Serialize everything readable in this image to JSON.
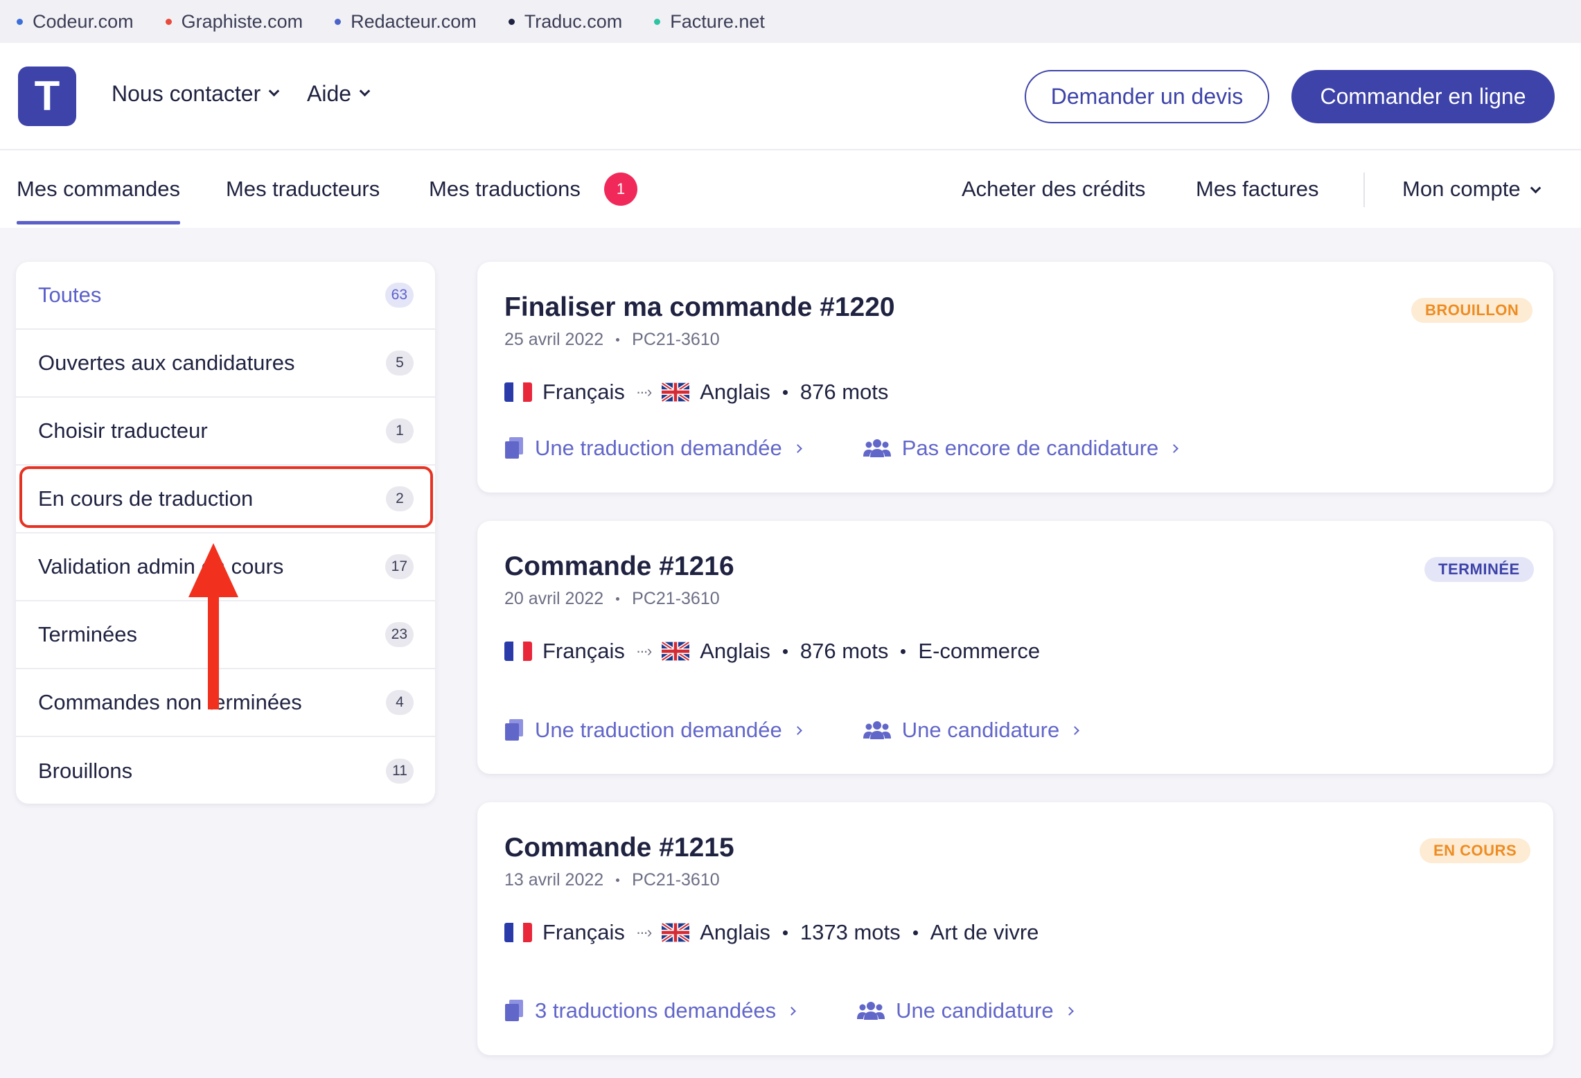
{
  "network": [
    {
      "label": "Codeur.com",
      "color": "#3d6fd8"
    },
    {
      "label": "Graphiste.com",
      "color": "#e84b3c"
    },
    {
      "label": "Redacteur.com",
      "color": "#4b63c9"
    },
    {
      "label": "Traduc.com",
      "color": "#1f2240"
    },
    {
      "label": "Facture.net",
      "color": "#2ec4a3"
    }
  ],
  "header": {
    "logo_letter": "T",
    "contact_label": "Nous contacter",
    "help_label": "Aide",
    "quote_button": "Demander un devis",
    "order_button": "Commander en ligne"
  },
  "nav": {
    "orders": "Mes commandes",
    "translators": "Mes traducteurs",
    "translations": "Mes traductions",
    "translations_badge": "1",
    "credits": "Acheter des crédits",
    "invoices": "Mes factures",
    "account": "Mon compte"
  },
  "sidebar": {
    "items": [
      {
        "label": "Toutes",
        "count": "63"
      },
      {
        "label": "Ouvertes aux candidatures",
        "count": "5"
      },
      {
        "label": "Choisir traducteur",
        "count": "1"
      },
      {
        "label": "En cours de traduction",
        "count": "2"
      },
      {
        "label": "Validation admin en cours",
        "count": "17"
      },
      {
        "label": "Terminées",
        "count": "23"
      },
      {
        "label": "Commandes non terminées",
        "count": "4"
      },
      {
        "label": "Brouillons",
        "count": "11"
      }
    ]
  },
  "orders": [
    {
      "title": "Finaliser ma commande #1220",
      "date": "25 avril 2022",
      "ref": "PC21-3610",
      "status": "BROUILLON",
      "source_lang": "Français",
      "target_lang": "Anglais",
      "words": "876 mots",
      "category": "",
      "translations_link": "Une traduction demandée",
      "applications_link": "Pas encore de candidature"
    },
    {
      "title": "Commande #1216",
      "date": "20 avril 2022",
      "ref": "PC21-3610",
      "status": "TERMINÉE",
      "source_lang": "Français",
      "target_lang": "Anglais",
      "words": "876 mots",
      "category": "E-commerce",
      "translations_link": "Une traduction demandée",
      "applications_link": "Une candidature"
    },
    {
      "title": "Commande #1215",
      "date": "13 avril 2022",
      "ref": "PC21-3610",
      "status": "EN COURS",
      "source_lang": "Français",
      "target_lang": "Anglais",
      "words": "1373 mots",
      "category": "Art de vivre",
      "translations_link": "3 traductions demandées",
      "applications_link": "Une candidature"
    }
  ],
  "colors": {
    "brand": "#3d43a8",
    "accent": "#5b60c9",
    "highlight": "#e53323"
  }
}
